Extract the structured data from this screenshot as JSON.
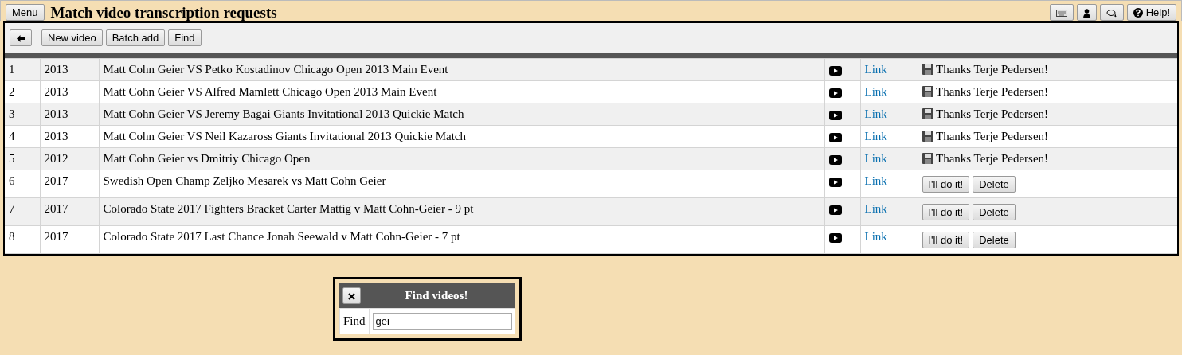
{
  "header": {
    "menu_button": "Menu",
    "title": "Match video transcription requests",
    "help_button": "Help!"
  },
  "toolbar": {
    "buttons": [
      "New video",
      "Batch add",
      "Find"
    ]
  },
  "rows": [
    {
      "number": "1",
      "year": "2013",
      "title": "Matt Cohn Geier VS Petko Kostadinov Chicago Open 2013 Main Event",
      "link": "Link",
      "kind": "thanks",
      "thanks": "Thanks Terje Pedersen!"
    },
    {
      "number": "2",
      "year": "2013",
      "title": "Matt Cohn Geier VS Alfred Mamlett Chicago Open 2013 Main Event",
      "link": "Link",
      "kind": "thanks",
      "thanks": "Thanks Terje Pedersen!"
    },
    {
      "number": "3",
      "year": "2013",
      "title": "Matt Cohn Geier VS Jeremy Bagai Giants Invitational 2013 Quickie Match",
      "link": "Link",
      "kind": "thanks",
      "thanks": "Thanks Terje Pedersen!"
    },
    {
      "number": "4",
      "year": "2013",
      "title": "Matt Cohn Geier VS Neil Kazaross Giants Invitational 2013 Quickie Match",
      "link": "Link",
      "kind": "thanks",
      "thanks": "Thanks Terje Pedersen!"
    },
    {
      "number": "5",
      "year": "2012",
      "title": "Matt Cohn Geier vs Dmitriy Chicago Open",
      "link": "Link",
      "kind": "thanks",
      "thanks": "Thanks Terje Pedersen!"
    },
    {
      "number": "6",
      "year": "2017",
      "title": "Swedish Open Champ Zeljko Mesarek vs Matt Cohn Geier",
      "link": "Link",
      "kind": "claim",
      "claim_button": "I'll do it!",
      "delete_button": "Delete"
    },
    {
      "number": "7",
      "year": "2017",
      "title": "Colorado State 2017 Fighters Bracket Carter Mattig v Matt Cohn-Geier - 9 pt",
      "link": "Link",
      "kind": "claim",
      "claim_button": "I'll do it!",
      "delete_button": "Delete"
    },
    {
      "number": "8",
      "year": "2017",
      "title": "Colorado State 2017 Last Chance Jonah Seewald v Matt Cohn-Geier - 7 pt",
      "link": "Link",
      "kind": "claim",
      "claim_button": "I'll do it!",
      "delete_button": "Delete"
    }
  ],
  "find_dialog": {
    "title": "Find videos!",
    "label": "Find",
    "value": "gei"
  }
}
